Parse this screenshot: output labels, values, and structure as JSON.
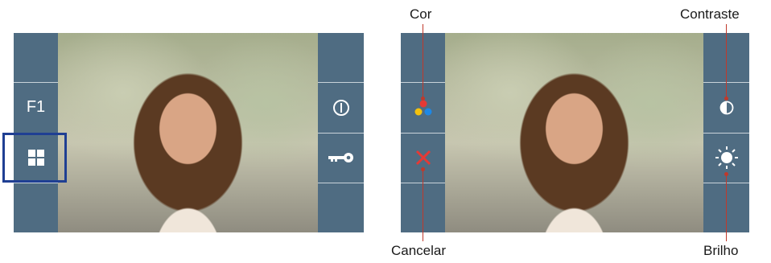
{
  "left_screen": {
    "left_panel": [
      "",
      "F1",
      "grid-icon",
      ""
    ],
    "right_panel": [
      "",
      "power-icon",
      "key-icon",
      ""
    ],
    "f1_label": "F1"
  },
  "right_screen": {
    "left_panel": [
      "",
      "color-icon",
      "close-icon",
      ""
    ],
    "right_panel": [
      "",
      "contrast-icon",
      "brightness-icon",
      ""
    ]
  },
  "callouts": {
    "cor": "Cor",
    "contraste": "Contraste",
    "cancelar": "Cancelar",
    "brilho": "Brilho"
  },
  "colors": {
    "panel": "#4f6c82",
    "selection": "#1f3f93",
    "leader": "#c0392b",
    "cancel_x": "#e53935"
  }
}
